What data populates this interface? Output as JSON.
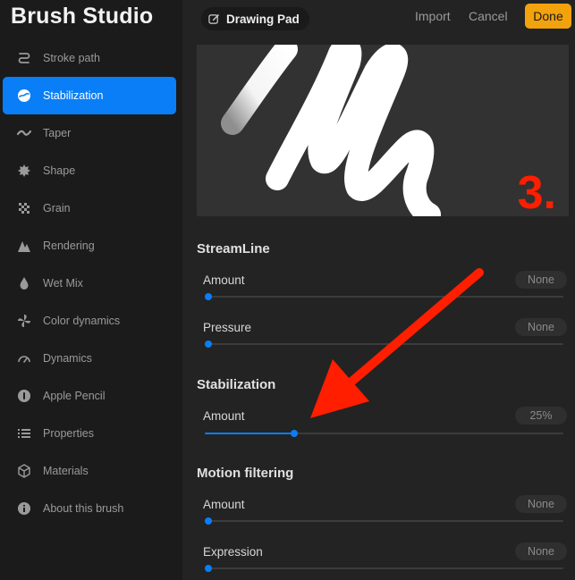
{
  "app": {
    "title": "Brush Studio"
  },
  "sidebar": {
    "items": [
      {
        "label": "Stroke path",
        "icon": "stroke-path-icon",
        "active": false
      },
      {
        "label": "Stabilization",
        "icon": "stabilization-icon",
        "active": true
      },
      {
        "label": "Taper",
        "icon": "taper-icon",
        "active": false
      },
      {
        "label": "Shape",
        "icon": "shape-icon",
        "active": false
      },
      {
        "label": "Grain",
        "icon": "grain-icon",
        "active": false
      },
      {
        "label": "Rendering",
        "icon": "rendering-icon",
        "active": false
      },
      {
        "label": "Wet Mix",
        "icon": "wet-mix-icon",
        "active": false
      },
      {
        "label": "Color dynamics",
        "icon": "color-dynamics-icon",
        "active": false
      },
      {
        "label": "Dynamics",
        "icon": "dynamics-icon",
        "active": false
      },
      {
        "label": "Apple Pencil",
        "icon": "apple-pencil-icon",
        "active": false
      },
      {
        "label": "Properties",
        "icon": "properties-icon",
        "active": false
      },
      {
        "label": "Materials",
        "icon": "materials-icon",
        "active": false
      },
      {
        "label": "About this brush",
        "icon": "info-icon",
        "active": false
      }
    ]
  },
  "topbar": {
    "drawing_pad": "Drawing Pad",
    "import": "Import",
    "cancel": "Cancel",
    "done": "Done"
  },
  "preview": {
    "annotation": "3."
  },
  "sections": [
    {
      "title": "StreamLine",
      "rows": [
        {
          "label": "Amount",
          "value": "None",
          "level": 0
        },
        {
          "label": "Pressure",
          "value": "None",
          "level": 0
        }
      ]
    },
    {
      "title": "Stabilization",
      "rows": [
        {
          "label": "Amount",
          "value": "25%",
          "level": 0.25
        }
      ]
    },
    {
      "title": "Motion filtering",
      "rows": [
        {
          "label": "Amount",
          "value": "None",
          "level": 0
        },
        {
          "label": "Expression",
          "value": "None",
          "level": 0
        }
      ]
    }
  ],
  "colors": {
    "accent": "#0a7ef6",
    "done": "#f2a20c",
    "annotation": "#ff1e00"
  }
}
